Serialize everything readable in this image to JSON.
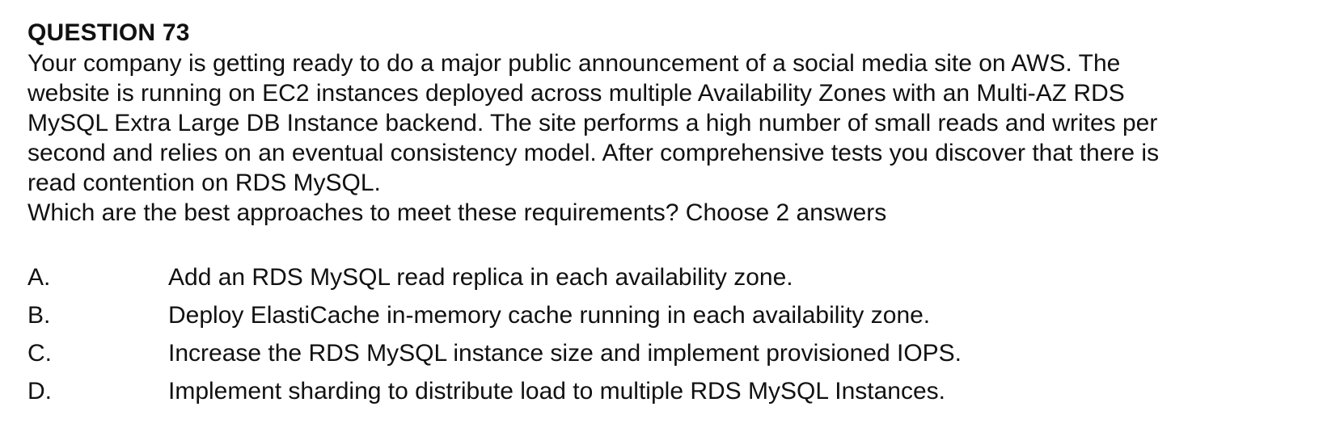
{
  "question": {
    "title": "QUESTION 73",
    "stem_lines": [
      "Your company is getting ready to do a major public announcement of a social media site on AWS. The",
      "website is running on EC2 instances deployed across multiple Availability Zones with an Multi-AZ RDS",
      "MySQL Extra Large DB Instance backend. The site performs a high number of small reads and writes per",
      "second and relies on an eventual consistency model. After comprehensive tests you discover that there is",
      "read contention on RDS MySQL."
    ],
    "prompt": "Which are the best approaches to meet these requirements? Choose 2 answers",
    "options": [
      {
        "letter": "A.",
        "text": "Add an RDS MySQL read replica in each availability zone."
      },
      {
        "letter": "B.",
        "text": "Deploy ElastiCache in-memory cache running in each availability zone."
      },
      {
        "letter": "C.",
        "text": "Increase the RDS MySQL instance size and implement provisioned IOPS."
      },
      {
        "letter": "D.",
        "text": "Implement sharding to distribute load to multiple RDS MySQL Instances."
      }
    ]
  }
}
